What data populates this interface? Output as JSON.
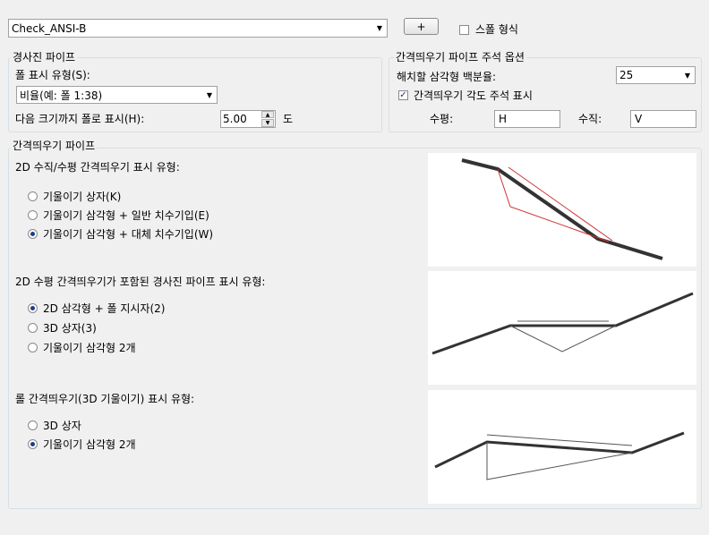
{
  "style_combo": {
    "value": "Check_ANSI-B"
  },
  "add_button": {
    "label": "+"
  },
  "style_format": {
    "label": "스폴 형식",
    "checked": false
  },
  "sloped_pipe": {
    "title": "경사진 파이프",
    "slope_display_type_label": "폴 표시 유형(S):",
    "slope_display_type_value": "비율(예: 폴 1:38)",
    "show_until_label": "다음 크기까지 폴로 표시(H):",
    "show_until_value": "5.00",
    "unit": "도"
  },
  "annotation_options": {
    "title": "간격띄우기 파이프 주석 옵션",
    "hatch_label": "해치할 삼각형 백분율:",
    "hatch_value": "25",
    "angle_label": "간격띄우기 각도 주석 표시",
    "angle_checked": true,
    "horizontal_label": "수평:",
    "horizontal_value": "H",
    "vertical_label": "수직:",
    "vertical_value": "V"
  },
  "offset_pipe": {
    "title": "간격띄우기 파이프",
    "section1": {
      "label": "2D 수직/수평 간격띄우기 표시 유형:",
      "options": [
        {
          "label": "기울이기 상자(K)",
          "selected": false
        },
        {
          "label": "기울이기 삼각형 + 일반 치수기입(E)",
          "selected": false
        },
        {
          "label": "기울이기 삼각형 + 대체 치수기입(W)",
          "selected": true
        }
      ]
    },
    "section2": {
      "label": "2D 수평 간격띄우기가 포함된 경사진 파이프 표시 유형:",
      "options": [
        {
          "label": "2D 삼각형 + 폴 지시자(2)",
          "selected": true
        },
        {
          "label": "3D 상자(3)",
          "selected": false
        },
        {
          "label": "기울이기 삼각형 2개",
          "selected": false
        }
      ]
    },
    "section3": {
      "label": "롤 간격띄우기(3D 기울이기) 표시 유형:",
      "options": [
        {
          "label": "3D 상자",
          "selected": false
        },
        {
          "label": "기울이기 삼각형 2개",
          "selected": true
        }
      ]
    }
  }
}
